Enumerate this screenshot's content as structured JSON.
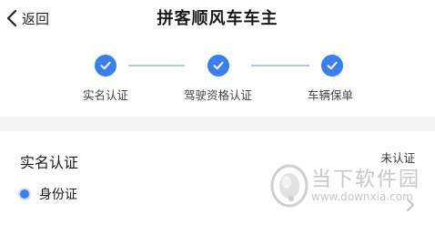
{
  "header": {
    "back_label": "返回",
    "title": "拼客顺风车车主"
  },
  "steps": [
    {
      "label": "实名认证",
      "status": "completed"
    },
    {
      "label": "驾驶资格认证",
      "status": "completed"
    },
    {
      "label": "车辆保单",
      "status": "completed"
    }
  ],
  "section": {
    "title": "实名认证",
    "status": "未认证",
    "items": [
      {
        "label": "身份证"
      }
    ]
  },
  "watermark": {
    "name": "当下软件园",
    "url": "www.downxia.com"
  },
  "colors": {
    "accent": "#3a7ff0",
    "line": "#a9c6f6",
    "divider": "#f4f4f4",
    "watermark": "#c8c8c8"
  },
  "icons": {
    "back": "chevron-left-icon",
    "step": "check-circle-icon",
    "row": "chevron-right-icon",
    "logo": "downxia-logo-icon"
  }
}
